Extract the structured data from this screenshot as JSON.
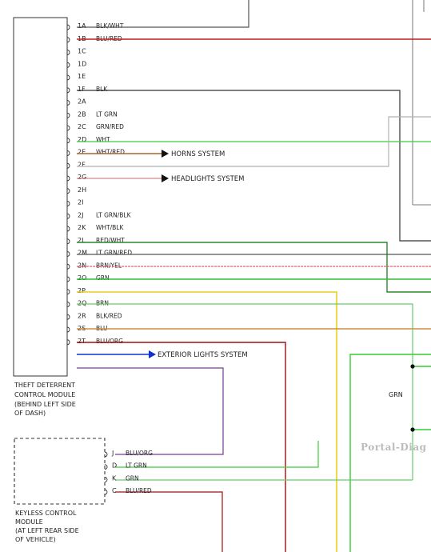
{
  "diagram": {
    "theft_module": {
      "label_lines": [
        "THEFT DETERRENT",
        "CONTROL MODULE",
        "(BEHIND LEFT SIDE",
        "OF DASH)"
      ],
      "pins": [
        {
          "pin": "1A",
          "wire": "BLK/WHT",
          "color": "#555555"
        },
        {
          "pin": "1B",
          "wire": "BLU/RED",
          "color": "#c01818"
        },
        {
          "pin": "1C",
          "wire": "",
          "color": ""
        },
        {
          "pin": "1D",
          "wire": "",
          "color": ""
        },
        {
          "pin": "1E",
          "wire": "",
          "color": ""
        },
        {
          "pin": "1F",
          "wire": "BLK",
          "color": "#333333"
        },
        {
          "pin": "2A",
          "wire": "",
          "color": ""
        },
        {
          "pin": "2B",
          "wire": "LT GRN",
          "color": "#3ccc3c"
        },
        {
          "pin": "2C",
          "wire": "GRN/RED",
          "color": "#b06030"
        },
        {
          "pin": "2D",
          "wire": "WHT",
          "color": "#b0b0b0"
        },
        {
          "pin": "2E",
          "wire": "WHT/RED",
          "color": "#d88888"
        },
        {
          "pin": "2F",
          "wire": "",
          "color": ""
        },
        {
          "pin": "2G",
          "wire": "",
          "color": ""
        },
        {
          "pin": "2H",
          "wire": "",
          "color": ""
        },
        {
          "pin": "2I",
          "wire": "",
          "color": ""
        },
        {
          "pin": "2J",
          "wire": "LT GRN/BLK",
          "color": "#2a8a2a"
        },
        {
          "pin": "2K",
          "wire": "WHT/BLK",
          "color": "#555555"
        },
        {
          "pin": "2L",
          "wire": "RED/WHT",
          "color": "#e06060"
        },
        {
          "pin": "2M",
          "wire": "LT GRN/RED",
          "color": "#2fbf2f"
        },
        {
          "pin": "2N",
          "wire": "BRN/YEL",
          "color": "#e8d020"
        },
        {
          "pin": "2O",
          "wire": "GRN",
          "color": "#66cc66"
        },
        {
          "pin": "2P",
          "wire": "",
          "color": ""
        },
        {
          "pin": "2Q",
          "wire": "BRN",
          "color": "#c89040"
        },
        {
          "pin": "2R",
          "wire": "BLK/RED",
          "color": "#a01010"
        },
        {
          "pin": "2S",
          "wire": "BLU",
          "color": "#1030d0"
        },
        {
          "pin": "2T",
          "wire": "BLU/ORG",
          "color": "#7a3a9a"
        }
      ]
    },
    "destinations": {
      "horns": "HORNS SYSTEM",
      "headlights": "HEADLIGHTS SYSTEM",
      "exterior": "EXTERIOR LIGHTS SYSTEM"
    },
    "grn_net_label": "GRN",
    "keyless_module": {
      "label_lines": [
        "KEYLESS CONTROL",
        "MODULE",
        "(AT LEFT REAR SIDE",
        "OF VEHICLE)"
      ],
      "pins": [
        {
          "pin": "J",
          "wire": "BLU/ORG",
          "color": "#7a3a9a"
        },
        {
          "pin": "D",
          "wire": "LT GRN",
          "color": "#3ccc3c"
        },
        {
          "pin": "K",
          "wire": "GRN",
          "color": "#66cc66"
        },
        {
          "pin": "C",
          "wire": "BLU/RED",
          "color": "#a01010"
        }
      ]
    },
    "watermark": "Portal-Diag"
  }
}
